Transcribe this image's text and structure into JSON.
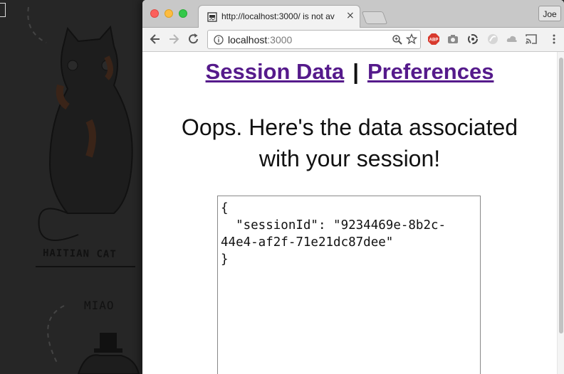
{
  "tab": {
    "title": "http://localhost:3000/ is not av",
    "close_glyph": "×"
  },
  "profile": {
    "label": "Joe"
  },
  "address_bar": {
    "host": "localhost",
    "port": ":3000"
  },
  "extensions": [
    "adblock-icon",
    "camera-icon",
    "sync-icon",
    "extension-icon",
    "drive-icon",
    "cast-icon",
    "menu-icon"
  ],
  "adblock_label": "ABP",
  "page": {
    "nav_session": "Session Data",
    "nav_separator": "|",
    "nav_preferences": "Preferences",
    "message_line1": "Oops. Here's the data associated",
    "message_line2": "with your session!",
    "json_text": "{\n  \"sessionId\": \"9234469e-8b2c-\n44e4-af2f-71e21dc87dee\"\n}"
  },
  "background": {
    "caption": "HAITIAN CAT",
    "miao": "MIAO"
  },
  "colors": {
    "link": "#551a8b",
    "tabstrip": "#c8c8c8",
    "adblock": "#d83a2e"
  }
}
